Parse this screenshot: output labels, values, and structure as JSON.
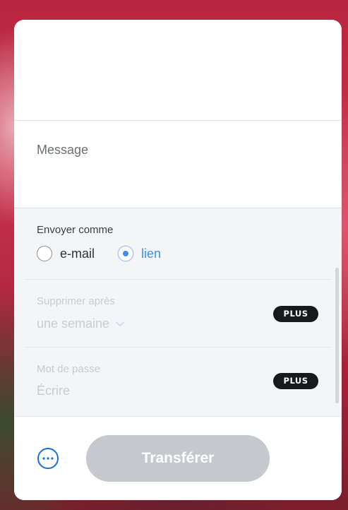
{
  "message": {
    "placeholder": "Message"
  },
  "send_as": {
    "label": "Envoyer comme",
    "options": [
      {
        "label": "e-mail",
        "selected": false
      },
      {
        "label": "lien",
        "selected": true
      }
    ]
  },
  "delete_after": {
    "label": "Supprimer après",
    "value": "une semaine",
    "badge": "PLUS"
  },
  "password": {
    "label": "Mot de passe",
    "placeholder": "Écrire",
    "badge": "PLUS"
  },
  "footer": {
    "more_icon": "more-horizontal-icon",
    "transfer_label": "Transférer"
  },
  "colors": {
    "accent": "#3d8ef0",
    "more_icon": "#1b6fd8",
    "badge_bg": "#17191c",
    "button_disabled": "#c5c8cc"
  }
}
